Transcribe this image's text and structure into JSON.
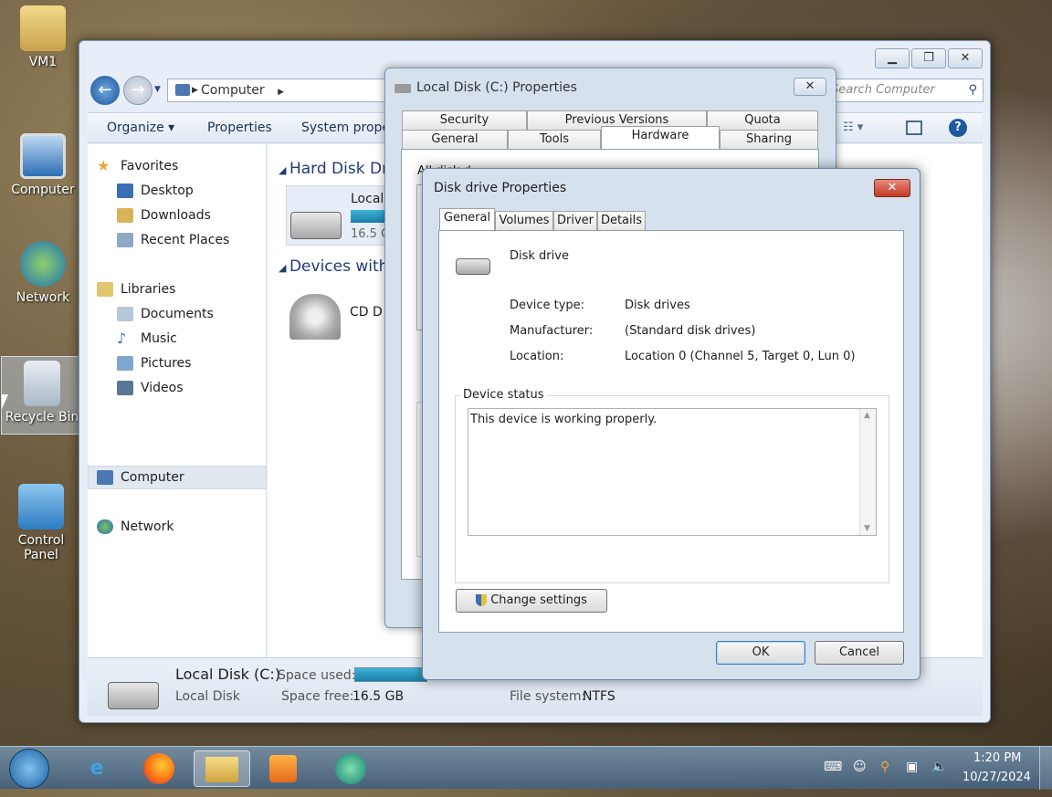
{
  "desktop": {
    "icons": [
      "VM1",
      "Computer",
      "Network",
      "Recycle Bin",
      "Control Panel"
    ]
  },
  "explorer": {
    "address": "Computer",
    "search_placeholder": "Search Computer",
    "toolbar": {
      "organize": "Organize",
      "properties": "Properties",
      "system_properties": "System prope"
    },
    "nav": {
      "favorites": "Favorites",
      "desktop": "Desktop",
      "downloads": "Downloads",
      "recent_places": "Recent Places",
      "libraries": "Libraries",
      "documents": "Documents",
      "music": "Music",
      "pictures": "Pictures",
      "videos": "Videos",
      "computer": "Computer",
      "network": "Network"
    },
    "sections": {
      "hard_disk": "Hard Disk Dr",
      "devices": "Devices with"
    },
    "drives": {
      "local_name": "Local",
      "local_free": "16.5 G",
      "cd_name": "CD D"
    },
    "details": {
      "name": "Local Disk (C:)",
      "type": "Local Disk",
      "space_used_label": "Space used:",
      "space_free_label": "Space free:",
      "space_free_value": "16.5 GB",
      "fs_label": "File system:",
      "fs_value": "NTFS"
    }
  },
  "ldprops": {
    "title": "Local Disk (C:) Properties",
    "tabs_row1": [
      "Security",
      "Previous Versions",
      "Quota"
    ],
    "tabs_row2": [
      "General",
      "Tools",
      "Hardware",
      "Sharing"
    ],
    "all_disk_label": "All disk d"
  },
  "ddprops": {
    "title": "Disk drive Properties",
    "tabs": [
      "General",
      "Volumes",
      "Driver",
      "Details"
    ],
    "device_name": "Disk drive",
    "device_type_label": "Device type:",
    "device_type_value": "Disk drives",
    "manufacturer_label": "Manufacturer:",
    "manufacturer_value": "(Standard disk drives)",
    "location_label": "Location:",
    "location_value": "Location 0 (Channel 5, Target 0, Lun 0)",
    "status_group": "Device status",
    "status_text": "This device is working properly.",
    "change_settings": "Change settings",
    "ok": "OK",
    "cancel": "Cancel"
  },
  "taskbar": {
    "time": "1:20 PM",
    "date": "10/27/2024"
  }
}
